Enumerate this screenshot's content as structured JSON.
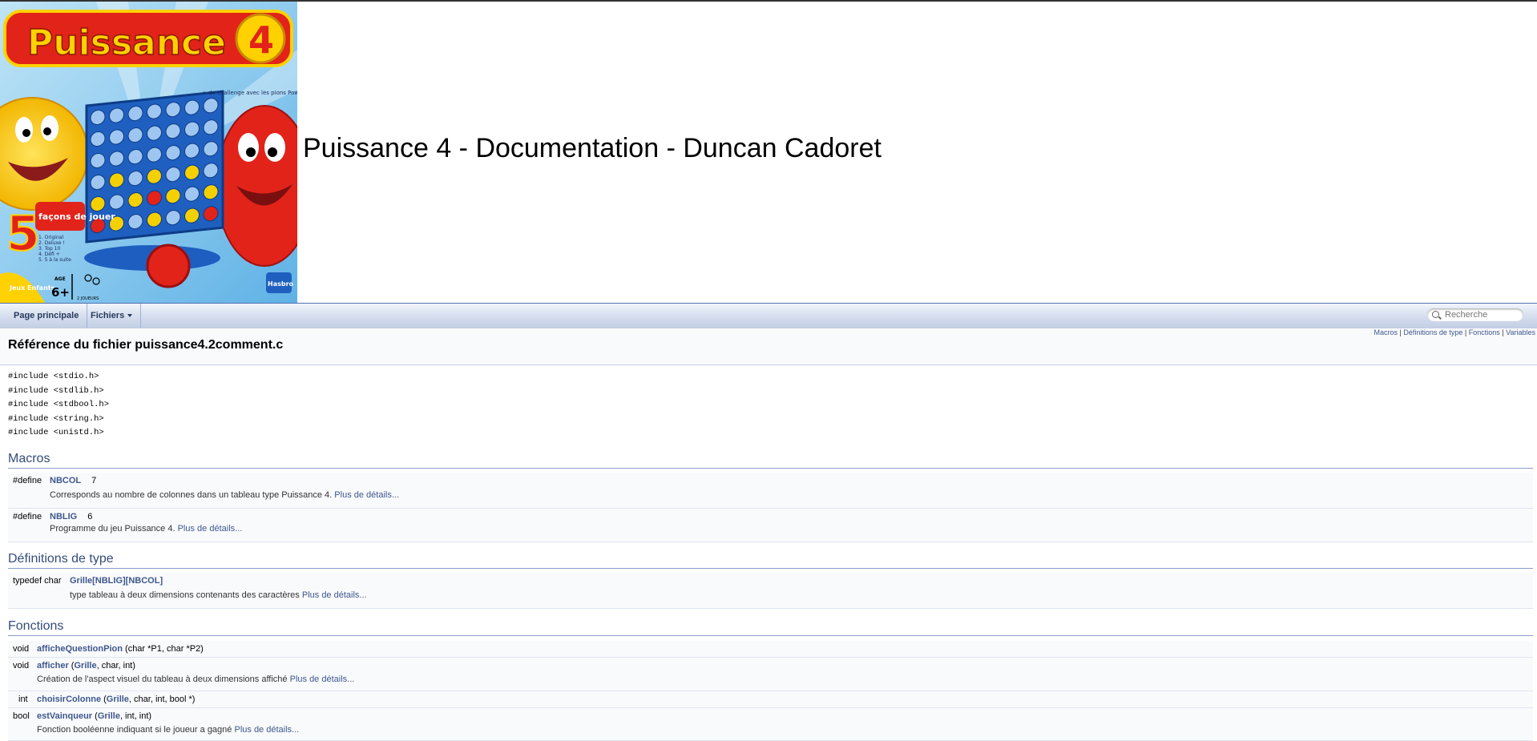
{
  "project": {
    "name": "Puissance 4 - Documentation - Duncan Cadoret",
    "logo": {
      "title_text": "Puissance",
      "title_number": "4",
      "challenge_text": "+ de challenge avec les pions Power !",
      "ways_number": "5",
      "ways_text": "façons de jouer",
      "modes": [
        "1. Original",
        "2. Deluxe !",
        "3. Top 10",
        "4. Défi +",
        "5. 5 à la suite"
      ],
      "badge": "Jeux Enfants",
      "age_label": "AGE",
      "age_value": "6+",
      "players": "2 JOUEURS",
      "brand": "Hasbro"
    }
  },
  "nav": {
    "main_page": "Page principale",
    "files": "Fichiers",
    "search_placeholder": "Recherche"
  },
  "summary_links": [
    "Macros",
    "Définitions de type",
    "Fonctions",
    "Variables"
  ],
  "page_title": "Référence du fichier puissance4.2comment.c",
  "includes": [
    "#include <stdio.h>",
    "#include <stdlib.h>",
    "#include <stdbool.h>",
    "#include <string.h>",
    "#include <unistd.h>"
  ],
  "more_label": "Plus de détails...",
  "macros": {
    "heading": "Macros",
    "items": [
      {
        "kw": "#define",
        "name": "NBCOL",
        "value": "7",
        "desc": "Corresponds au nombre de colonnes dans un tableau type Puissance 4."
      },
      {
        "kw": "#define",
        "name": "NBLIG",
        "value": "6",
        "desc": "Programme du jeu Puissance 4."
      }
    ]
  },
  "typedefs": {
    "heading": "Définitions de type",
    "items": [
      {
        "kw": "typedef char",
        "name": "Grille[NBLIG][NBCOL]",
        "desc": "type tableau à deux dimensions contenants des caractères"
      }
    ]
  },
  "functions": {
    "heading": "Fonctions",
    "items": [
      {
        "ret": "void",
        "name": "afficheQuestionPion",
        "args": " (char *P1, char *P2)",
        "desc": ""
      },
      {
        "ret": "void",
        "name": "afficher",
        "args_pre": " (",
        "args_link": "Grille",
        "args_post": ", char, int)",
        "desc": "Création de l'aspect visuel du tableau à deux dimensions affiché"
      },
      {
        "ret": "int",
        "name": "choisirColonne",
        "args_pre": " (",
        "args_link": "Grille",
        "args_post": ", char, int, bool *)",
        "desc": ""
      },
      {
        "ret": "bool",
        "name": "estVainqueur",
        "args_pre": " (",
        "args_link": "Grille",
        "args_post": ", int, int)",
        "desc": "Fonction booléenne indiquant si le joueur a gagné"
      }
    ]
  },
  "colors": {
    "link": "#3d578c",
    "section_heading": "#354c7b",
    "row_background": "#f9fafc"
  }
}
